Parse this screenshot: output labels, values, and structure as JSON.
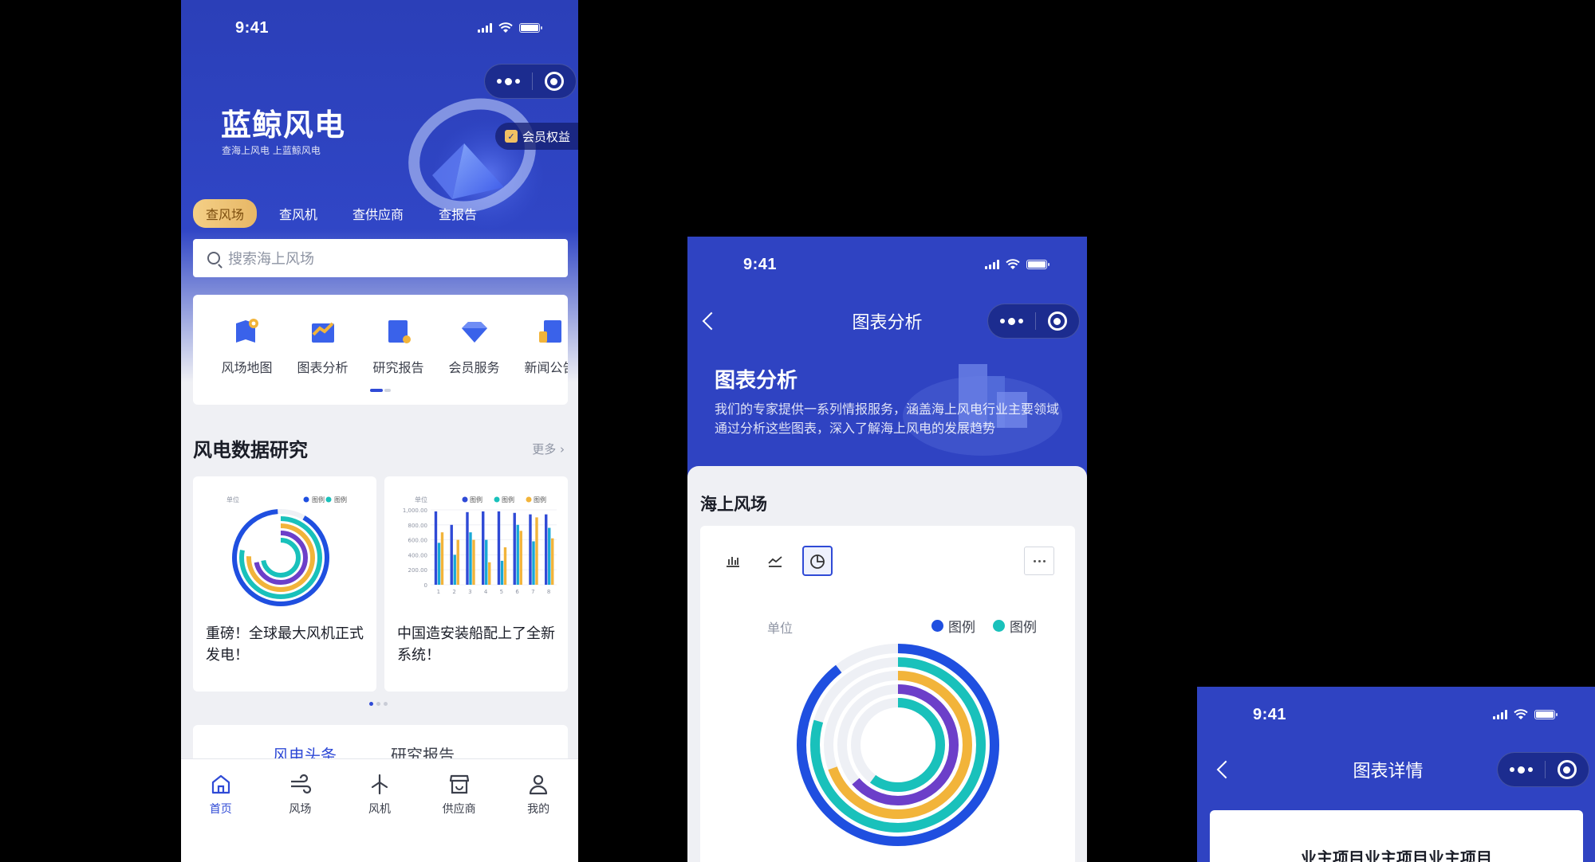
{
  "status": {
    "time": "9:41"
  },
  "home": {
    "brand": "蓝鲸风电",
    "brand_sub": "查海上风电 上蓝鲸风电",
    "vip_label": "会员权益",
    "tabs": [
      "查风场",
      "查风机",
      "查供应商",
      "查报告"
    ],
    "search_placeholder": "搜索海上风场",
    "quick": [
      "风场地图",
      "图表分析",
      "研究报告",
      "会员服务",
      "新闻公告"
    ],
    "section_title": "风电数据研究",
    "more_label": "更多",
    "cards": [
      {
        "title": "重磅！全球最大风机正式发电！",
        "chart": {
          "unit": "单位",
          "legend": [
            "图例",
            "图例"
          ]
        }
      },
      {
        "title": "中国造安装船配上了全新系统！",
        "chart": {
          "unit": "单位",
          "legend": [
            "图例",
            "图例",
            "图例"
          ],
          "y_ticks": [
            "1,000.00",
            "800.00",
            "600.00",
            "400.00",
            "200.00",
            "0"
          ],
          "x_ticks": [
            "1",
            "2",
            "3",
            "4",
            "5",
            "6",
            "7",
            "8"
          ]
        }
      }
    ],
    "news_tabs": [
      "风电头条",
      "研究报告"
    ],
    "bottom_nav": [
      "首页",
      "风场",
      "风机",
      "供应商",
      "我的"
    ]
  },
  "analysis": {
    "nav_title": "图表分析",
    "heading": "图表分析",
    "description": "我们的专家提供一系列情报服务，涵盖海上风电行业主要领域 通过分析这些图表，深入了解海上风电的发展趋势",
    "section": "海上风场",
    "unit": "单位",
    "legend": [
      {
        "name": "图例",
        "color": "#1f4fe0"
      },
      {
        "name": "图例",
        "color": "#19c1bb"
      }
    ]
  },
  "detail": {
    "nav_title": "图表详情",
    "card_title": "业主项目业主项目业主项目"
  },
  "chart_data": [
    {
      "type": "bar",
      "title": "",
      "ylabel": "单位",
      "categories": [
        "1",
        "2",
        "3",
        "4",
        "5",
        "6",
        "7",
        "8"
      ],
      "ylim": [
        0,
        1000
      ],
      "series": [
        {
          "name": "图例",
          "color": "#2f4ad6",
          "values": [
            980,
            800,
            970,
            980,
            980,
            960,
            940,
            940
          ]
        },
        {
          "name": "图例",
          "color": "#19a9d6",
          "values": [
            560,
            400,
            700,
            600,
            320,
            800,
            580,
            760
          ]
        },
        {
          "name": "图例",
          "color": "#f2b43a",
          "values": [
            700,
            600,
            600,
            300,
            500,
            720,
            900,
            620
          ]
        }
      ]
    }
  ],
  "colors": {
    "primary": "#2f43c2",
    "accent": "#2f4ad6",
    "gold": "#f2b43a",
    "teal": "#19c1bb",
    "purple": "#6c3fc9"
  }
}
